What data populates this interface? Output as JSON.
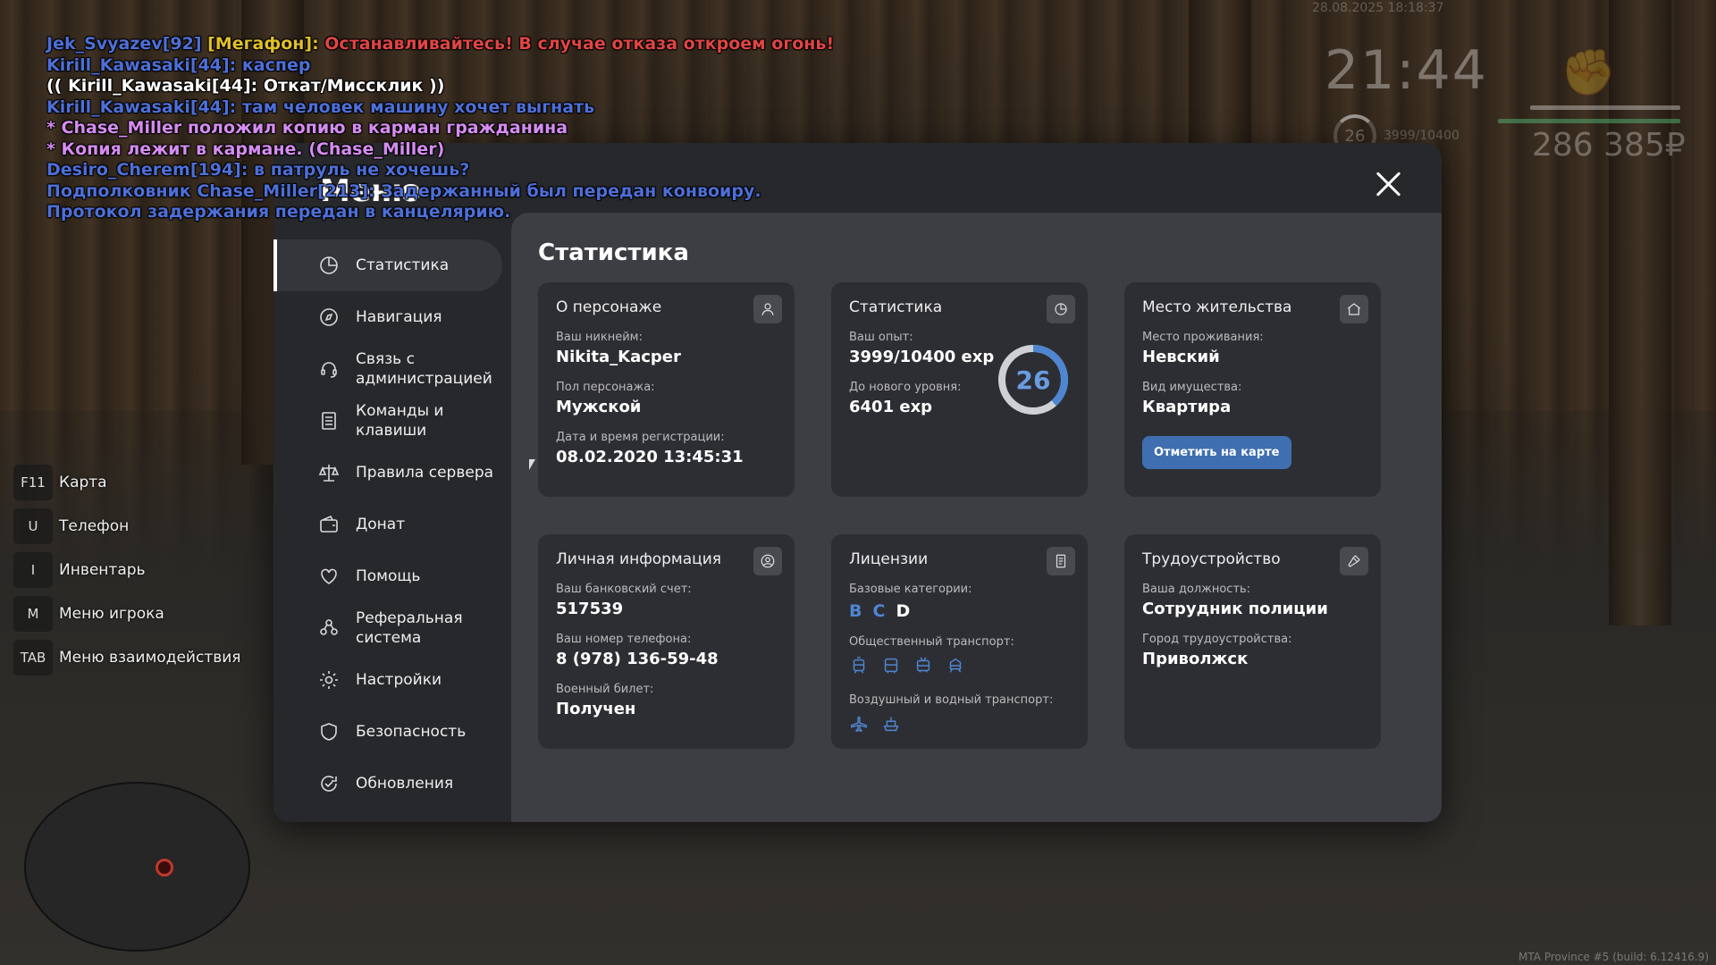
{
  "hud": {
    "datetime": "28.08.2025 18:18:37",
    "clock": "21:44",
    "money": "286 385₽",
    "level": "26",
    "exp": "3999/10400"
  },
  "chat": [
    {
      "text": "Jek_Svyazev[92] [Мегафон]: ",
      "color": "#4d6fd8",
      "rest": "Останавливайтесь! В случае отказа откроем огонь!",
      "rest_color": "#e04545",
      "tag": "[Мегафон]: ",
      "tag_color": "#e0c028",
      "name": "Jek_Svyazev[92] "
    },
    {
      "text": "Kirill_Kawasaki[44]: каспер",
      "color": "#ffffff"
    },
    {
      "text": "(( Kirill_Kawasaki[44]: Откат/Миссклик ))",
      "color": "#ffffff"
    },
    {
      "text": "Kirill_Kawasaki[44]: там человек машину хочет выгнать",
      "color": "#ffffff"
    },
    {
      "text": "* Chase_Miller положил копию в карман гражданина",
      "color": "#d58cf0"
    },
    {
      "text": "* Копия лежит в кармане. (Chase_Miller)",
      "color": "#d58cf0"
    },
    {
      "text": "Desiro_Cherem[194]: в патруль не хочешь?",
      "color": "#ffffff"
    },
    {
      "text": "Подполковник Chase_Miller[213]: Задержанный был передан конвоиру. Протокол задержания передан в канцелярию.",
      "color": "#4d6fd8"
    }
  ],
  "keyhints": [
    {
      "key": "F11",
      "label": "Карта"
    },
    {
      "key": "U",
      "label": "Телефон"
    },
    {
      "key": "I",
      "label": "Инвентарь"
    },
    {
      "key": "M",
      "label": "Меню игрока"
    },
    {
      "key": "TAB",
      "label": "Меню взаимодействия"
    }
  ],
  "build": "MTA Province #5 (build: 6.12416.9)",
  "menu": {
    "title": "Меню",
    "nav": [
      {
        "id": "stats",
        "label": "Статистика",
        "icon": "pie-chart-icon"
      },
      {
        "id": "navigation",
        "label": "Навигация",
        "icon": "compass-icon"
      },
      {
        "id": "admin-contact",
        "label": "Связь с администрацией",
        "icon": "headset-icon"
      },
      {
        "id": "commands",
        "label": "Команды и клавиши",
        "icon": "document-list-icon"
      },
      {
        "id": "rules",
        "label": "Правила сервера",
        "icon": "scales-icon"
      },
      {
        "id": "donate",
        "label": "Донат",
        "icon": "wallet-icon"
      },
      {
        "id": "help",
        "label": "Помощь",
        "icon": "heart-hand-icon"
      },
      {
        "id": "referral",
        "label": "Реферальная система",
        "icon": "referral-people-icon"
      },
      {
        "id": "settings",
        "label": "Настройки",
        "icon": "gear-icon"
      },
      {
        "id": "security",
        "label": "Безопасность",
        "icon": "shield-icon"
      },
      {
        "id": "updates",
        "label": "Обновления",
        "icon": "refresh-check-icon"
      }
    ],
    "active": "stats"
  },
  "stats": {
    "title": "Статистика",
    "character": {
      "title": "О персонаже",
      "nickname_label": "Ваш никнейм:",
      "nickname": "Nikita_Kacper",
      "gender_label": "Пол персонажа:",
      "gender": "Мужской",
      "reg_label": "Дата и время регистрации:",
      "reg": "08.02.2020 13:45:31"
    },
    "experience": {
      "title": "Статистика",
      "exp_label": "Ваш опыт:",
      "exp": "3999/10400 exp",
      "next_label": "До нового уровня:",
      "next": "6401 exp",
      "level": "26",
      "progress": 0.3845,
      "ring_color": "#4f86d2"
    },
    "residence": {
      "title": "Место жительства",
      "place_label": "Место проживания:",
      "place": "Невский",
      "property_label": "Вид имущества:",
      "property": "Квартира",
      "button": "Отметить на карте"
    },
    "personal": {
      "title": "Личная информация",
      "bank_label": "Ваш банковский счет:",
      "bank": "517539",
      "phone_label": "Ваш номер телефона:",
      "phone": "8 (978) 136-59-48",
      "military_label": "Военный билет:",
      "military": "Получен"
    },
    "licenses": {
      "title": "Лицензии",
      "base_label": "Базовые категории:",
      "categories": [
        {
          "letter": "B",
          "owned": true
        },
        {
          "letter": "C",
          "owned": true
        },
        {
          "letter": "D",
          "owned": false
        }
      ],
      "public_label": "Общественный транспорт:",
      "air_label": "Воздушный и водный транспорт:"
    },
    "employment": {
      "title": "Трудоустройство",
      "position_label": "Ваша должность:",
      "position": "Сотрудник полиции",
      "city_label": "Город трудоустройства:",
      "city": "Приволжск"
    }
  }
}
